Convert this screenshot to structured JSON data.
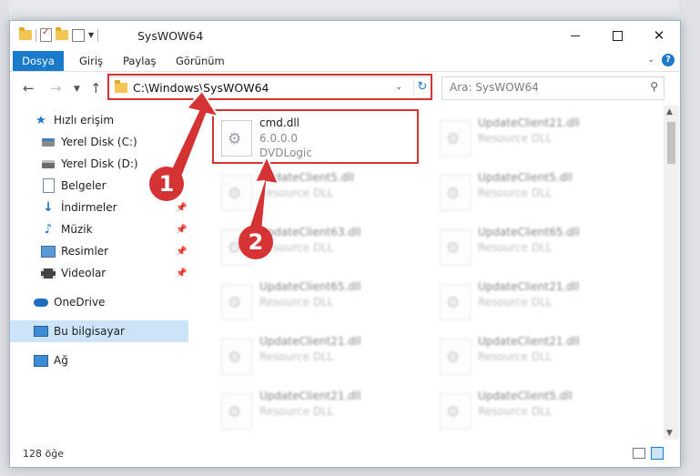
{
  "window": {
    "title": "SysWOW64"
  },
  "ribbon": {
    "tabs": [
      "Dosya",
      "Giriş",
      "Paylaş",
      "Görünüm"
    ]
  },
  "address": {
    "path": "C:\\Windows\\SysWOW64",
    "search_placeholder": "Ara: SysWOW64"
  },
  "nav": {
    "items": [
      {
        "label": "Hızlı erişim",
        "icon": "star-icon"
      },
      {
        "label": "Yerel Disk (C:)",
        "icon": "drive-icon"
      },
      {
        "label": "Yerel Disk (D:)",
        "icon": "drive-icon"
      },
      {
        "label": "Belgeler",
        "icon": "documents-icon"
      },
      {
        "label": "İndirmeler",
        "icon": "download-icon"
      },
      {
        "label": "Müzik",
        "icon": "music-icon"
      },
      {
        "label": "Resimler",
        "icon": "pictures-icon"
      },
      {
        "label": "Videolar",
        "icon": "videos-icon"
      },
      {
        "label": "OneDrive",
        "icon": "cloud-icon"
      },
      {
        "label": "Bu bilgisayar",
        "icon": "computer-icon"
      },
      {
        "label": "Ağ",
        "icon": "network-icon"
      }
    ]
  },
  "files": [
    {
      "name": "cmd.dll",
      "line2": "6.0.0.0",
      "line3": "DVDLogic"
    },
    {
      "name": "UpdateClient21.dll",
      "line2": "Resource DLL"
    },
    {
      "name": "UpdateClient5.dll",
      "line2": "Resource DLL"
    },
    {
      "name": "UpdateClient5.dll",
      "line2": "Resource DLL"
    },
    {
      "name": "UpdateClient63.dll",
      "line2": "Resource DLL"
    },
    {
      "name": "UpdateClient65.dll",
      "line2": "Resource DLL"
    },
    {
      "name": "UpdateClient65.dll",
      "line2": "Resource DLL"
    },
    {
      "name": "UpdateClient21.dll",
      "line2": "Resource DLL"
    },
    {
      "name": "UpdateClient21.dll",
      "line2": "Resource DLL"
    },
    {
      "name": "UpdateClient21.dll",
      "line2": "Resource DLL"
    },
    {
      "name": "UpdateClient21.dll",
      "line2": "Resource DLL"
    },
    {
      "name": "UpdateClient5.dll",
      "line2": "Resource DLL"
    }
  ],
  "status": {
    "item_count": "128 öğe"
  },
  "annotations": {
    "step1": "1",
    "step2": "2",
    "color": "#d53333"
  }
}
